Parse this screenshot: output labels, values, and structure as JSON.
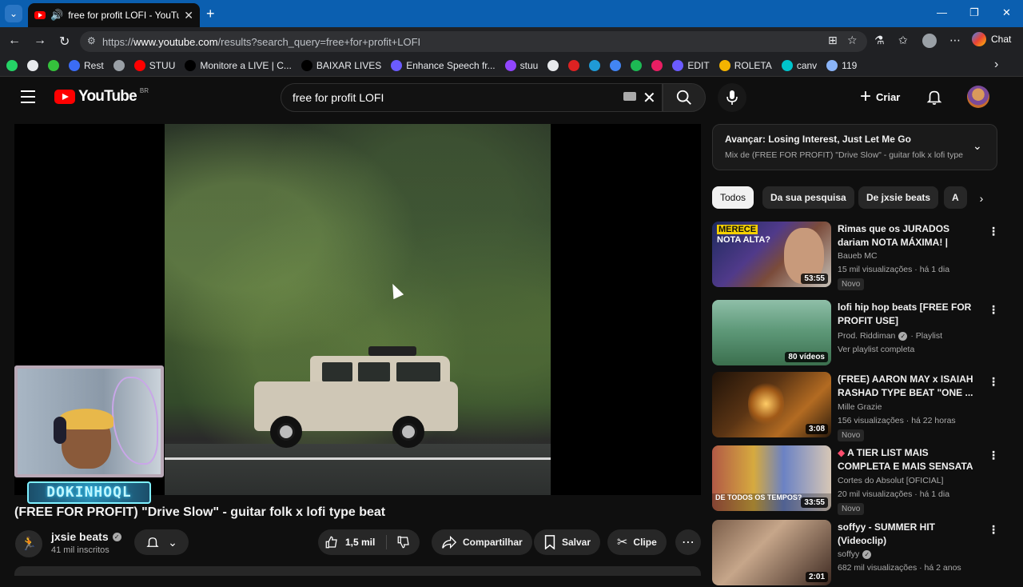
{
  "browser": {
    "tab_title": "free for profit LOFI - YouTube",
    "url_prefix": "https://",
    "url_domain": "www.youtube.com",
    "url_path": "/results?search_query=free+for+profit+LOFI",
    "chat_label": "Chat",
    "bookmarks": [
      {
        "label": "",
        "color": "#25d366"
      },
      {
        "label": "",
        "color": "#e8eaed"
      },
      {
        "label": "",
        "color": "#35c23c"
      },
      {
        "label": "Rest",
        "color": "#3b6cf6"
      },
      {
        "label": "",
        "color": "#9aa0a6"
      },
      {
        "label": "STUU",
        "color": "#ff0000"
      },
      {
        "label": "Monitore a LIVE | C...",
        "color": "#000000"
      },
      {
        "label": "BAIXAR LIVES",
        "color": "#000000"
      },
      {
        "label": "Enhance Speech fr...",
        "color": "#6b5bff"
      },
      {
        "label": "stuu",
        "color": "#9146ff"
      },
      {
        "label": "",
        "color": "#e8eaed"
      },
      {
        "label": "",
        "color": "#d22"
      },
      {
        "label": "",
        "color": "#1f9ad6"
      },
      {
        "label": "",
        "color": "#4285f4"
      },
      {
        "label": "",
        "color": "#1db954"
      },
      {
        "label": "",
        "color": "#e91e63"
      },
      {
        "label": "EDIT",
        "color": "#6b5bff"
      },
      {
        "label": "ROLETA",
        "color": "#f4b400"
      },
      {
        "label": "canv",
        "color": "#00c4cc"
      },
      {
        "label": "119",
        "color": "#8ab4f8"
      }
    ]
  },
  "youtube": {
    "logo_text": "YouTube",
    "region": "BR",
    "search_value": "free for profit LOFI",
    "create_label": "Criar"
  },
  "player": {
    "streamer_name": "DOKINHOQL"
  },
  "video": {
    "title": "(FREE FOR PROFIT) \"Drive Slow\" - guitar folk x lofi type beat",
    "channel": "jxsie beats",
    "subscribers": "41 mil inscritos",
    "likes": "1,5 mil",
    "share_label": "Compartilhar",
    "save_label": "Salvar",
    "clip_label": "Clipe"
  },
  "up_next": {
    "title": "Avançar: Losing Interest, Just Let Me Go",
    "subtitle": "Mix de (FREE FOR PROFIT) \"Drive Slow\" - guitar folk x lofi type"
  },
  "chips": [
    "Todos",
    "Da sua pesquisa",
    "De jxsie beats",
    "A"
  ],
  "recommendations": [
    {
      "title": "Rimas que os JURADOS dariam NOTA MÁXIMA! | REACT BAUEB",
      "channel": "Baueb MC",
      "stats": "15 mil visualizações · há 1 dia",
      "badge": "Novo",
      "duration": "53:55",
      "thumb_text_1": "MERECE",
      "thumb_text_2": "NOTA ALTA?"
    },
    {
      "title": "lofi hip hop beats [FREE FOR PROFIT USE]",
      "channel": "Prod. Riddiman",
      "channel_suffix": "· Playlist",
      "extra": "Ver playlist completa",
      "duration": "80 vídeos"
    },
    {
      "title": "(FREE) AARON MAY x ISAIAH RASHAD TYPE BEAT \"ONE ...",
      "channel": "Mille Grazie",
      "stats": "156 visualizações · há 22 horas",
      "badge": "Novo",
      "duration": "3:08"
    },
    {
      "title": "A TIER LIST MAIS COMPLETA E MAIS SENSATA ...",
      "channel": "Cortes do Absolut [OFICIAL]",
      "stats": "20 mil visualizações · há 1 dia",
      "badge": "Novo",
      "duration": "33:55",
      "thumb_text": "DE TODOS OS TEMPOS?"
    },
    {
      "title": "soffyy - SUMMER HIT (Videoclip)",
      "channel": "soffyy",
      "stats": "682 mil visualizações · há 2 anos",
      "duration": "2:01"
    }
  ]
}
